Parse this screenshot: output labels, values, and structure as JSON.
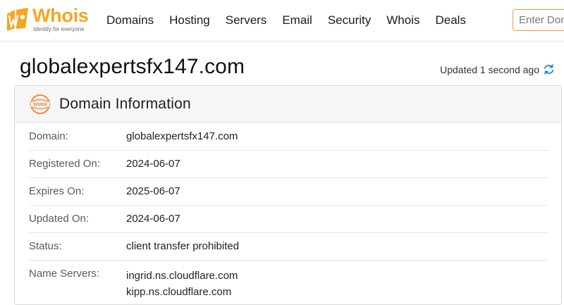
{
  "header": {
    "logo": {
      "wordmark": "Whois",
      "tagline": "Identity for everyone",
      "icon": "whois-logo-icon",
      "brand_color": "#f5a623"
    },
    "nav": [
      {
        "label": "Domains"
      },
      {
        "label": "Hosting"
      },
      {
        "label": "Servers"
      },
      {
        "label": "Email"
      },
      {
        "label": "Security"
      },
      {
        "label": "Whois"
      },
      {
        "label": "Deals"
      }
    ],
    "search": {
      "placeholder": "Enter Domain or IP",
      "value": "",
      "border_color": "#f09b3a"
    }
  },
  "page": {
    "title": "globalexpertsfx147.com",
    "updated_text": "Updated 1 second ago",
    "refresh_icon": "refresh-icon",
    "refresh_color": "#2a7fd4"
  },
  "domain_info": {
    "title": "Domain Information",
    "icon": "www-icon",
    "icon_color": "#f08a3e",
    "rows": [
      {
        "label": "Domain:",
        "value": "globalexpertsfx147.com"
      },
      {
        "label": "Registered On:",
        "value": "2024-06-07"
      },
      {
        "label": "Expires On:",
        "value": "2025-06-07"
      },
      {
        "label": "Updated On:",
        "value": "2024-06-07"
      },
      {
        "label": "Status:",
        "value": "client transfer prohibited"
      }
    ],
    "name_servers": {
      "label": "Name Servers:",
      "values": [
        "ingrid.ns.cloudflare.com",
        "kipp.ns.cloudflare.com"
      ]
    }
  }
}
